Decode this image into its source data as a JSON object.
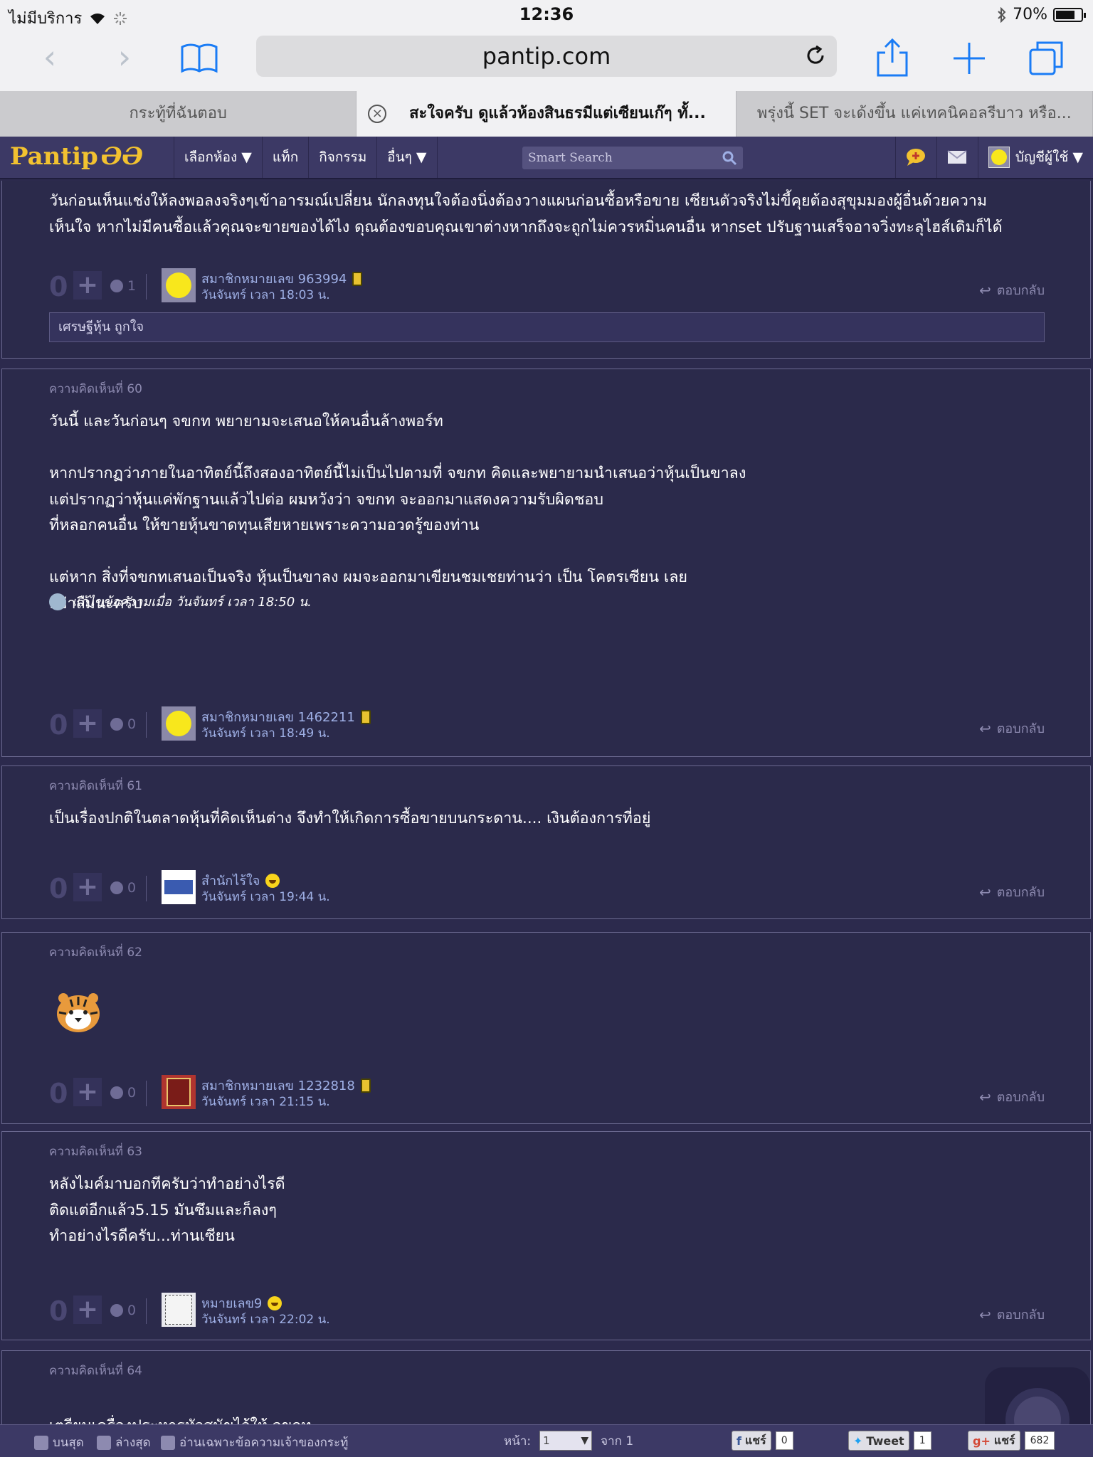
{
  "status": {
    "carrier": "ไม่มีบริการ",
    "time": "12:36",
    "battery": "70%"
  },
  "browser": {
    "url": "pantip.com",
    "tabs": [
      {
        "label": "กระทู้ที่ฉันตอบ"
      },
      {
        "label": "สะใจครับ ดูแล้วห้องสินธรมีแต่เซียนเก๊ๆ ทั้..."
      },
      {
        "label": "พรุ่งนี้ SET จะเด้งขึ้น แค่เทคนิคอลรีบาว หรือ..."
      }
    ]
  },
  "pantip_nav": {
    "logo_text": "Pantip",
    "logo_mark": "ƏƏ",
    "menu": [
      "เลือกห้อง ▼",
      "แท็ก",
      "กิจกรรม",
      "อื่นๆ ▼"
    ],
    "search_placeholder": "Smart Search",
    "account_label": "บัญชีผู้ใช้ ▼"
  },
  "comments": [
    {
      "number_label": "",
      "body": "วันก่อนเห็นแช่งให้ลงพอลงจริงๆเข้าอารมณ์เปลี่ยน นักลงทุนใจต้องนิ่งต้องวางแผนก่อนซื้อหรือขาย เซียนตัวจริงไม่ขี้คุยต้องสุขุมมองผู้อื่นด้วยความ\nเห็นใจ หากไม่มีคนซื้อแล้วคุณจะขายของได้ไง ดุณต้องขอบคุณเขาต่างหากถึงจะถูกไม่ควรหมิ่นคนอื่น หากset ปรับฐานเสร็จอาจวิ่งทะลุไฮส์เดิมก็ได้",
      "score": "0",
      "emotions": "1",
      "user": "สมาชิกหมายเลข 963994",
      "date": "วันจันทร์ เวลา 18:03 น.",
      "reply_label": "ตอบกลับ",
      "tag": "เศรษฐีหุ้น ถูกใจ"
    },
    {
      "number_label": "ความคิดเห็นที่ 60",
      "body": "วันนี้ และวันก่อนๆ จขกท พยายามจะเสนอให้คนอื่นล้างพอร์ท\n\nหากปรากฏว่าภายในอาทิตย์นี้ถึงสองอาทิตย์นี้ไม่เป็นไปตามที่ จขกท คิดและพยายามนำเสนอว่าหุ้นเป็นขาลง\nแต่ปรากฏว่าหุ้นแค่พักฐานแล้วไปต่อ ผมหวังว่า จขกท จะออกมาแสดงความรับผิดชอบ\nที่หลอกคนอื่น ให้ขายหุ้นขาดทุนเสียหายเพราะความอวดรู้ของท่าน\n\nแต่หาก สิ่งที่จขกทเสนอเป็นจริง หุ้นเป็นขาลง ผมจะออกมาเขียนชมเชยท่านว่า เป็น โคตรเซียน เลย\nอย่าลืมนะครับ",
      "edit_note": "แก้ไขข้อความเมื่อ วันจันทร์ เวลา 18:50 น.",
      "score": "0",
      "emotions": "0",
      "user": "สมาชิกหมายเลข 1462211",
      "date": "วันจันทร์ เวลา 18:49 น.",
      "reply_label": "ตอบกลับ"
    },
    {
      "number_label": "ความคิดเห็นที่ 61",
      "body": "เป็นเรื่องปกติในตลาดหุ้นที่คิดเห็นต่าง  จึงทำให้เกิดการซื้อขายบนกระดาน.... เงินต้องการที่อยู่",
      "score": "0",
      "emotions": "0",
      "user": "สำนักไร้ใจ",
      "date": "วันจันทร์ เวลา 19:44 น.",
      "reply_label": "ตอบกลับ"
    },
    {
      "number_label": "ความคิดเห็นที่ 62",
      "body": "",
      "score": "0",
      "emotions": "0",
      "user": "สมาชิกหมายเลข 1232818",
      "date": "วันจันทร์ เวลา 21:15 น.",
      "reply_label": "ตอบกลับ"
    },
    {
      "number_label": "ความคิดเห็นที่ 63",
      "body": "หลังไมค์มาบอกทีครับว่าทำอย่างไรดี\nติดแต่อีกแล้ว5.15 มันซึมและก็ลงๆ\nทำอย่างไรดีครับ...ท่านเซียน",
      "score": "0",
      "emotions": "0",
      "user": "หมายเลข9",
      "date": "วันจันทร์ เวลา 22:02 น.",
      "reply_label": "ตอบกลับ"
    },
    {
      "number_label": "ความคิดเห็นที่ 64",
      "body": "เตรียมเครื่องประหารหัวสุนัขไว้ให้ จขกท"
    }
  ],
  "bottom_bar": {
    "top_label": "บนสุด",
    "bottom_label": "ล่างสุด",
    "owner_only_label": "อ่านเฉพาะข้อความเจ้าของกระทู้",
    "page_label": "หน้า:",
    "page_value": "1",
    "of_label": "จาก 1",
    "fb_label": "แชร์",
    "fb_count": "0",
    "tweet_label": "Tweet",
    "tweet_count": "1",
    "gplus_label": "แชร์",
    "gplus_count": "682"
  }
}
